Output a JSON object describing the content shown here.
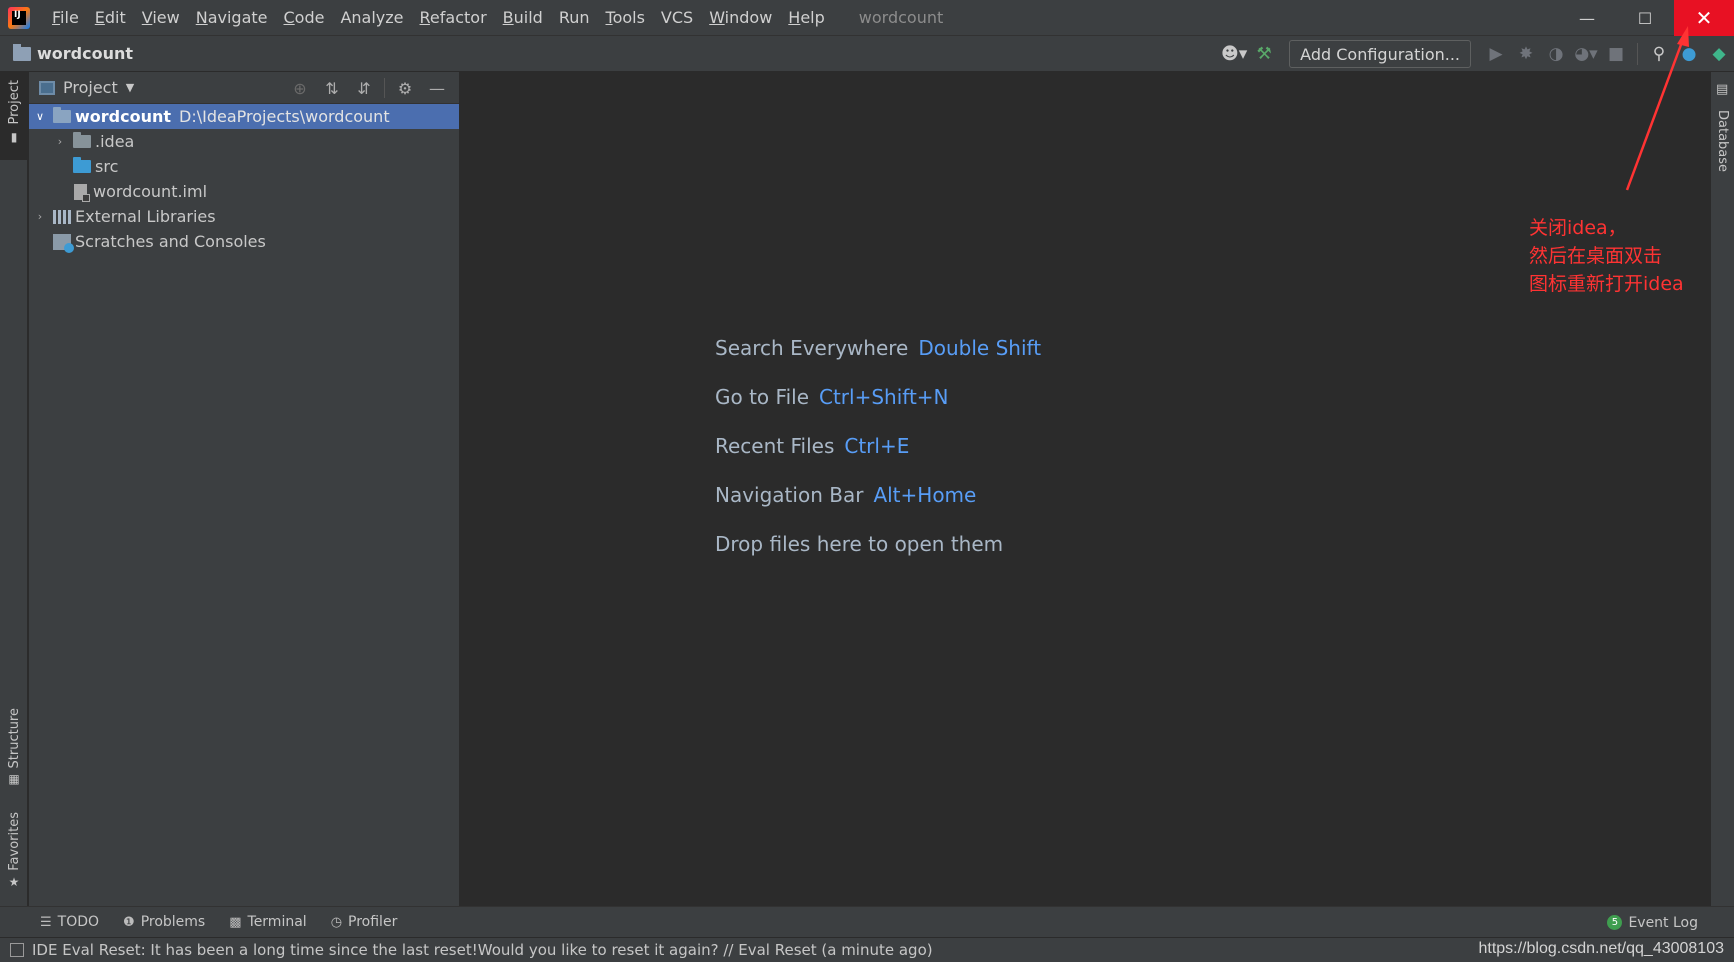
{
  "titlebar": {
    "menu": [
      {
        "label": "File",
        "mnemonic": "F",
        "rest": "ile"
      },
      {
        "label": "Edit",
        "mnemonic": "E",
        "rest": "dit"
      },
      {
        "label": "View",
        "mnemonic": "V",
        "rest": "iew"
      },
      {
        "label": "Navigate",
        "mnemonic": "N",
        "rest": "avigate"
      },
      {
        "label": "Code",
        "mnemonic": "C",
        "rest": "ode"
      },
      {
        "label": "Analyze",
        "mnemonic": "",
        "rest": "Analyze"
      },
      {
        "label": "Refactor",
        "mnemonic": "R",
        "rest": "efactor"
      },
      {
        "label": "Build",
        "mnemonic": "B",
        "rest": "uild"
      },
      {
        "label": "Run",
        "mnemonic": "",
        "rest": "Run"
      },
      {
        "label": "Tools",
        "mnemonic": "T",
        "rest": "ools"
      },
      {
        "label": "VCS",
        "mnemonic": "",
        "rest": "VCS"
      },
      {
        "label": "Window",
        "mnemonic": "W",
        "rest": "indow"
      },
      {
        "label": "Help",
        "mnemonic": "H",
        "rest": "elp"
      }
    ],
    "window_title": "wordcount",
    "controls": {
      "minimize": "—",
      "maximize": "☐",
      "close": "✕"
    }
  },
  "navbar": {
    "project_name": "wordcount",
    "add_configuration": "Add Configuration..."
  },
  "left_stripe": {
    "project": "Project",
    "structure": "Structure",
    "favorites": "Favorites"
  },
  "right_stripe": {
    "database": "Database"
  },
  "project_panel": {
    "title": "Project",
    "tree": [
      {
        "name": "wordcount",
        "path": "D:\\IdeaProjects\\wordcount",
        "selected": true
      },
      {
        "name": ".idea"
      },
      {
        "name": "src"
      },
      {
        "name": "wordcount.iml"
      },
      {
        "name": "External Libraries"
      },
      {
        "name": "Scratches and Consoles"
      }
    ]
  },
  "editor": {
    "hints": [
      {
        "label": "Search Everywhere",
        "key": "Double Shift"
      },
      {
        "label": "Go to File",
        "key": "Ctrl+Shift+N"
      },
      {
        "label": "Recent Files",
        "key": "Ctrl+E"
      },
      {
        "label": "Navigation Bar",
        "key": "Alt+Home"
      },
      {
        "label": "Drop files here to open them",
        "key": ""
      }
    ]
  },
  "annotation": {
    "line1": "关闭idea，",
    "line2": "然后在桌面双击",
    "line3": "图标重新打开idea",
    "color": "#ff3333"
  },
  "bottom_tools": {
    "todo": "TODO",
    "problems": "Problems",
    "terminal": "Terminal",
    "profiler": "Profiler",
    "event_log": "Event Log",
    "event_count": "5"
  },
  "statusbar": {
    "message": "IDE Eval Reset: It has been a long time since the last reset!Would you like to reset it again? // Eval Reset (a minute ago)",
    "watermark": "https://blog.csdn.net/qq_43008103"
  },
  "colors": {
    "selection": "#4b6eaf",
    "key_hint": "#589df6",
    "close_button": "#e81123"
  }
}
